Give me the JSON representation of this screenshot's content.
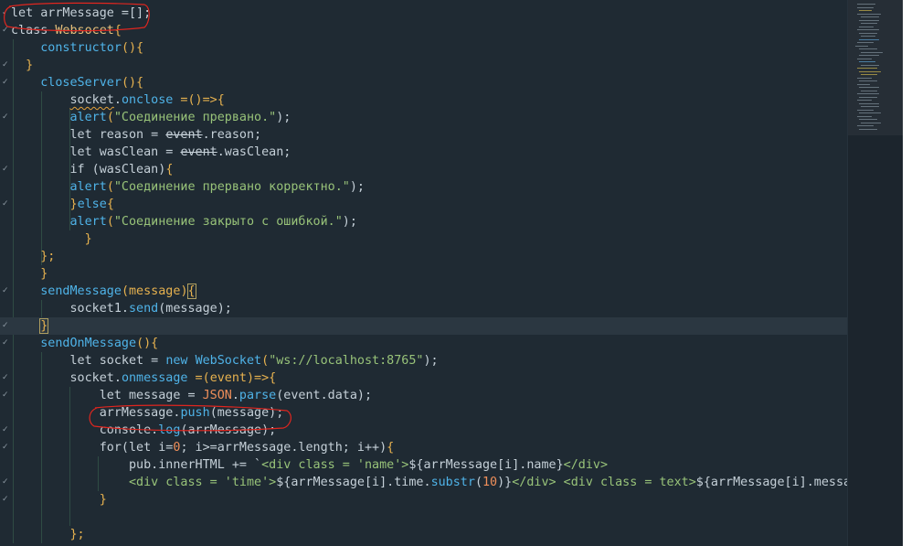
{
  "editor": {
    "lines": [
      [
        [
          "let arrMessage =[];",
          "kw"
        ]
      ],
      [
        [
          "class ",
          "kw"
        ],
        [
          "Websocet",
          "cls"
        ],
        [
          "{",
          "par"
        ]
      ],
      [
        [
          "    ",
          ""
        ],
        [
          "constructor",
          "fn"
        ],
        [
          "(){",
          "par"
        ]
      ],
      [
        [
          "  ",
          ""
        ],
        [
          "}",
          "par"
        ]
      ],
      [
        [
          "    ",
          ""
        ],
        [
          "closeServer",
          "fn"
        ],
        [
          "(){",
          "par"
        ]
      ],
      [
        [
          "        ",
          ""
        ],
        [
          "socket",
          "squig"
        ],
        [
          ".",
          "kw"
        ],
        [
          "onclose",
          "fn"
        ],
        [
          " =()=>{",
          "par"
        ]
      ],
      [
        [
          "        ",
          ""
        ],
        [
          "alert",
          "fn"
        ],
        [
          "(",
          "par"
        ],
        [
          "\"Соединение прервано.\"",
          "str"
        ],
        [
          ");",
          "kw"
        ]
      ],
      [
        [
          "        let reason = ",
          "kw"
        ],
        [
          "event",
          "strike"
        ],
        [
          ".reason;",
          "kw"
        ]
      ],
      [
        [
          "        let wasClean = ",
          "kw"
        ],
        [
          "event",
          "strike"
        ],
        [
          ".wasClean;",
          "kw"
        ]
      ],
      [
        [
          "        if (wasClean)",
          "kw"
        ],
        [
          "{",
          "par"
        ]
      ],
      [
        [
          "        ",
          ""
        ],
        [
          "alert",
          "fn"
        ],
        [
          "(",
          "par"
        ],
        [
          "\"Соединение прервано корректно.\"",
          "str"
        ],
        [
          ");",
          "kw"
        ]
      ],
      [
        [
          "        ",
          ""
        ],
        [
          "}",
          "par"
        ],
        [
          "else",
          "fn"
        ],
        [
          "{",
          "par"
        ]
      ],
      [
        [
          "        ",
          ""
        ],
        [
          "alert",
          "fn"
        ],
        [
          "(",
          "par"
        ],
        [
          "\"Соединение закрыто с ошибкой.\"",
          "str"
        ],
        [
          ");",
          "kw"
        ]
      ],
      [
        [
          "          ",
          ""
        ],
        [
          "}",
          "par"
        ]
      ],
      [
        [
          "    ",
          ""
        ],
        [
          "};",
          "par"
        ]
      ],
      [
        [
          "    ",
          ""
        ],
        [
          "}",
          "par"
        ]
      ],
      [
        [
          "    ",
          ""
        ],
        [
          "sendMessage",
          "fn"
        ],
        [
          "(",
          "par"
        ],
        [
          "message",
          "par"
        ],
        [
          ")",
          "par"
        ],
        [
          "{",
          "bhl"
        ]
      ],
      [
        [
          "        socket1.",
          "kw"
        ],
        [
          "send",
          "fn"
        ],
        [
          "(message);",
          "kw"
        ]
      ],
      [
        [
          "    ",
          ""
        ],
        [
          "}",
          "bhl"
        ]
      ],
      [
        [
          "    ",
          ""
        ],
        [
          "sendOnMessage",
          "fn"
        ],
        [
          "(){",
          "par"
        ]
      ],
      [
        [
          "        let socket = ",
          "kw"
        ],
        [
          "new ",
          "fn"
        ],
        [
          "WebSocket",
          "fn"
        ],
        [
          "(",
          "par"
        ],
        [
          "\"ws://localhost:8765\"",
          "str"
        ],
        [
          ");",
          "kw"
        ]
      ],
      [
        [
          "        socket.",
          "kw"
        ],
        [
          "onmessage",
          "fn"
        ],
        [
          " =(",
          "par"
        ],
        [
          "event",
          "par"
        ],
        [
          ")=>{",
          "par"
        ]
      ],
      [
        [
          "            let message = ",
          "kw"
        ],
        [
          "JSON",
          "num"
        ],
        [
          ".",
          "kw"
        ],
        [
          "parse",
          "fn"
        ],
        [
          "(event.data);",
          "kw"
        ]
      ],
      [
        [
          "            arrMessage.",
          "kw"
        ],
        [
          "push",
          "fn"
        ],
        [
          "(message);",
          "kw"
        ]
      ],
      [
        [
          "            console.",
          "kw"
        ],
        [
          "log",
          "fn"
        ],
        [
          "(arrMessage);",
          "kw"
        ]
      ],
      [
        [
          "            for(let i=",
          "kw"
        ],
        [
          "0",
          "num"
        ],
        [
          "; i>=arrMessage.length; i++)",
          "kw"
        ],
        [
          "{",
          "par"
        ]
      ],
      [
        [
          "                pub.innerHTML += `",
          "kw"
        ],
        [
          "<div class = 'name'>",
          "str"
        ],
        [
          "${arrMessage[i].name}",
          "kw"
        ],
        [
          "</div>",
          "str"
        ]
      ],
      [
        [
          "                ",
          ""
        ],
        [
          "<div class = 'time'>",
          "str"
        ],
        [
          "${arrMessage[i].time.",
          "kw"
        ],
        [
          "substr",
          "fn"
        ],
        [
          "(",
          "kw"
        ],
        [
          "10",
          "num"
        ],
        [
          ")}",
          "kw"
        ],
        [
          "</div> <div class = text>",
          "str"
        ],
        [
          "${arrMessage[i].message}",
          "kw"
        ],
        [
          "</",
          "str"
        ]
      ],
      [
        [
          "            ",
          ""
        ],
        [
          "}",
          "par"
        ]
      ],
      [
        [
          "",
          ""
        ]
      ],
      [
        [
          "        ",
          ""
        ],
        [
          "};",
          "par"
        ]
      ]
    ]
  }
}
